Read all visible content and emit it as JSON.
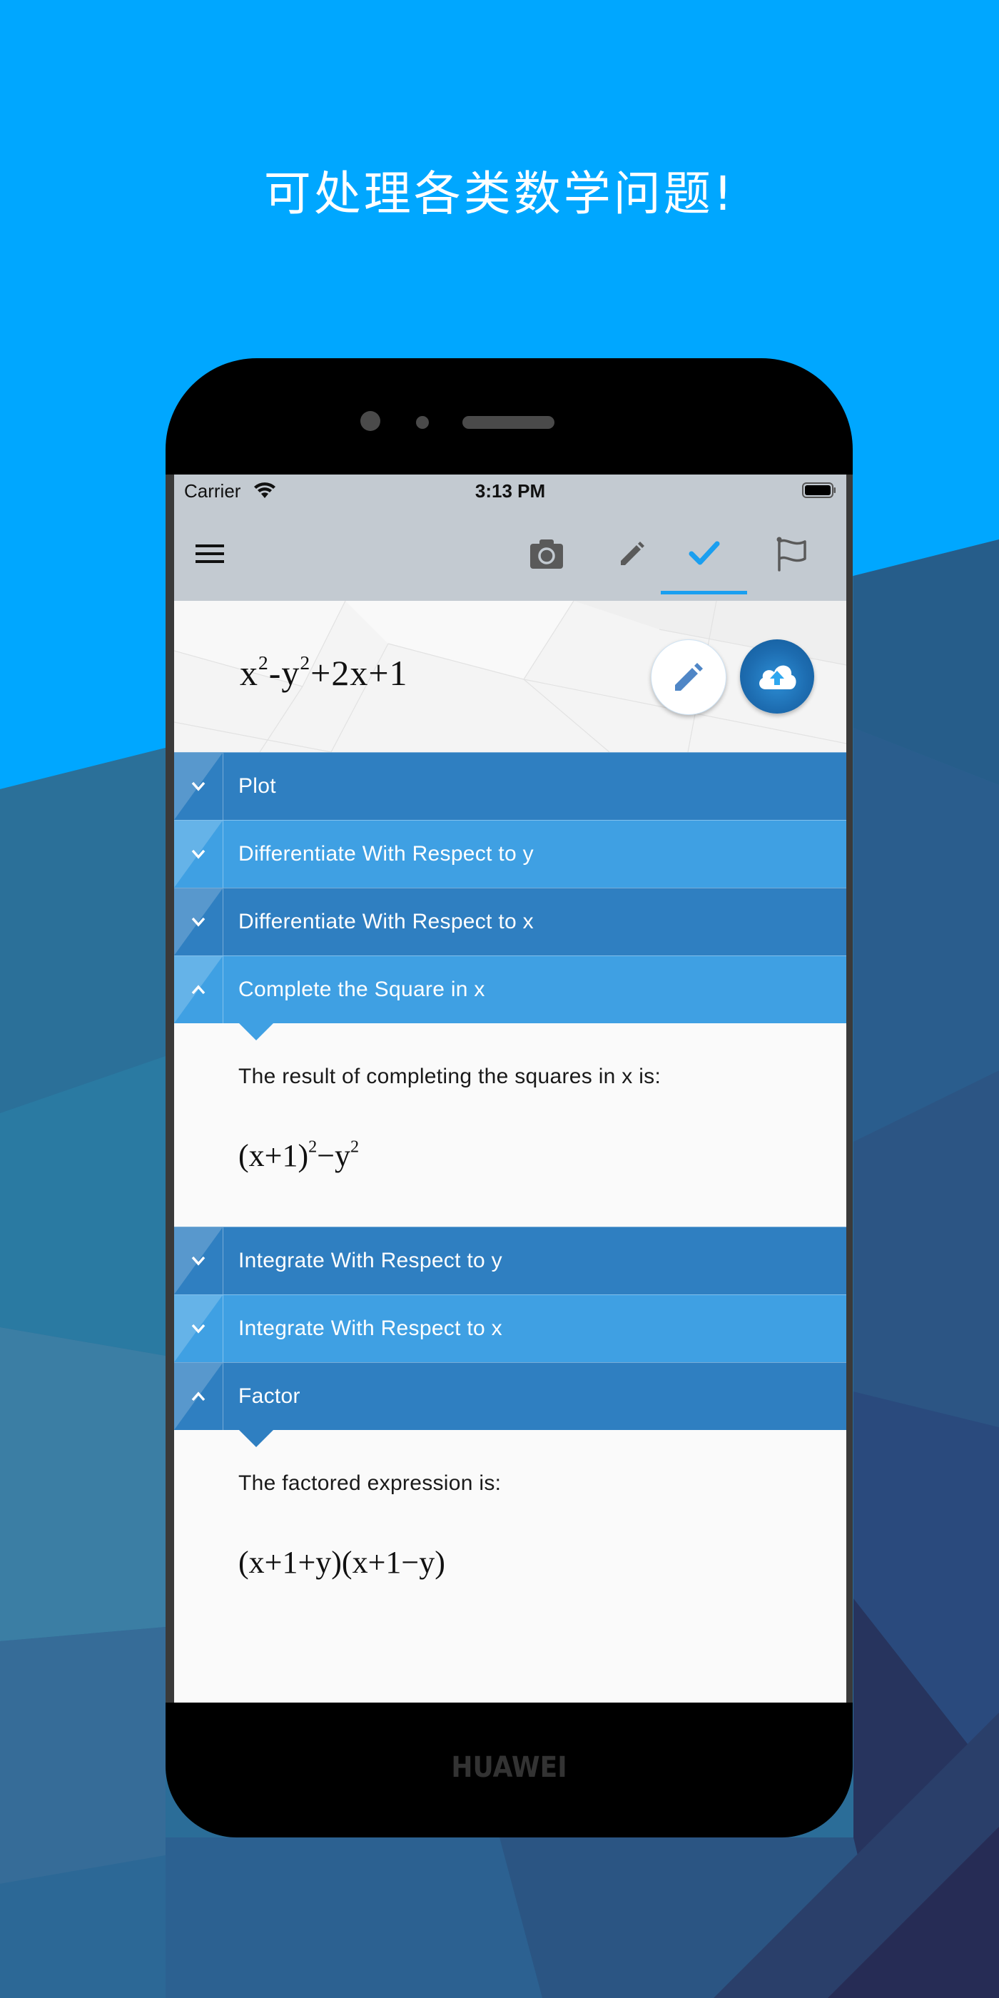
{
  "promo": {
    "headline": "可处理各类数学问题!"
  },
  "device": {
    "brand": "HUAWEI"
  },
  "status_bar": {
    "carrier": "Carrier",
    "time": "3:13 PM",
    "wifi_icon": "wifi-icon",
    "battery_icon": "battery-full-icon"
  },
  "toolbar": {
    "menu_icon": "hamburger-menu-icon",
    "tabs": [
      {
        "name": "camera",
        "icon": "camera-icon",
        "active": false
      },
      {
        "name": "edit",
        "icon": "pencil-icon",
        "active": false
      },
      {
        "name": "solve",
        "icon": "checkmark-icon",
        "active": true
      },
      {
        "name": "report",
        "icon": "flag-icon",
        "active": false
      }
    ],
    "active_color": "#1a9ff0",
    "inactive_color": "#5a5a5a"
  },
  "expression": {
    "parts": [
      "x",
      "2",
      "-y",
      "2",
      "+2x+1"
    ],
    "edit_button_icon": "pencil-icon",
    "upload_button_icon": "cloud-upload-icon"
  },
  "accordion": {
    "colors": {
      "dark": "#2f7fc1",
      "light": "#3fa0e3"
    },
    "items": [
      {
        "label": "Plot",
        "expanded": false
      },
      {
        "label": "Differentiate With Respect to y",
        "expanded": false
      },
      {
        "label": "Differentiate With Respect to x",
        "expanded": false
      },
      {
        "label": "Complete the Square in x",
        "expanded": true,
        "body_text": "The result of completing the squares in x is:",
        "result_parts": [
          "(x+1)",
          "2",
          "−y",
          "2"
        ]
      },
      {
        "label": "Integrate With Respect to y",
        "expanded": false
      },
      {
        "label": "Integrate With Respect to x",
        "expanded": false
      },
      {
        "label": "Factor",
        "expanded": true,
        "body_text": "The factored expression is:",
        "result": "(x+1+y)(x+1−y)"
      }
    ]
  }
}
